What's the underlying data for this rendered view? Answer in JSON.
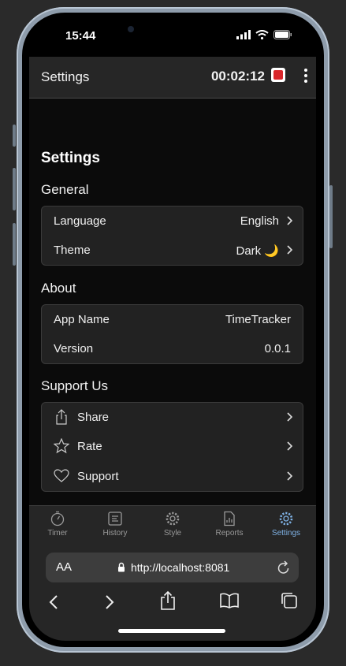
{
  "status": {
    "time": "15:44"
  },
  "appbar": {
    "title": "Settings",
    "timer": "00:02:12"
  },
  "page": {
    "title": "Settings"
  },
  "general": {
    "title": "General",
    "rows": [
      {
        "label": "Language",
        "value": "English"
      },
      {
        "label": "Theme",
        "value": "Dark 🌙"
      }
    ]
  },
  "about": {
    "title": "About",
    "rows": [
      {
        "label": "App Name",
        "value": "TimeTracker"
      },
      {
        "label": "Version",
        "value": "0.0.1"
      }
    ]
  },
  "support": {
    "title": "Support Us",
    "rows": [
      {
        "label": "Share",
        "icon": "share-icon"
      },
      {
        "label": "Rate",
        "icon": "star-icon"
      },
      {
        "label": "Support",
        "icon": "heart-icon"
      }
    ]
  },
  "tabs": [
    {
      "label": "Timer",
      "icon": "stopwatch-icon"
    },
    {
      "label": "History",
      "icon": "list-icon"
    },
    {
      "label": "Style",
      "icon": "gear-icon"
    },
    {
      "label": "Reports",
      "icon": "report-icon"
    },
    {
      "label": "Settings",
      "icon": "gear-icon",
      "active": true
    }
  ],
  "browser": {
    "aa": "AA",
    "url": "http://localhost:8081"
  },
  "colors": {
    "accent": "#7fb2e5",
    "record": "#d9262b",
    "background": "#0b0b0b"
  }
}
